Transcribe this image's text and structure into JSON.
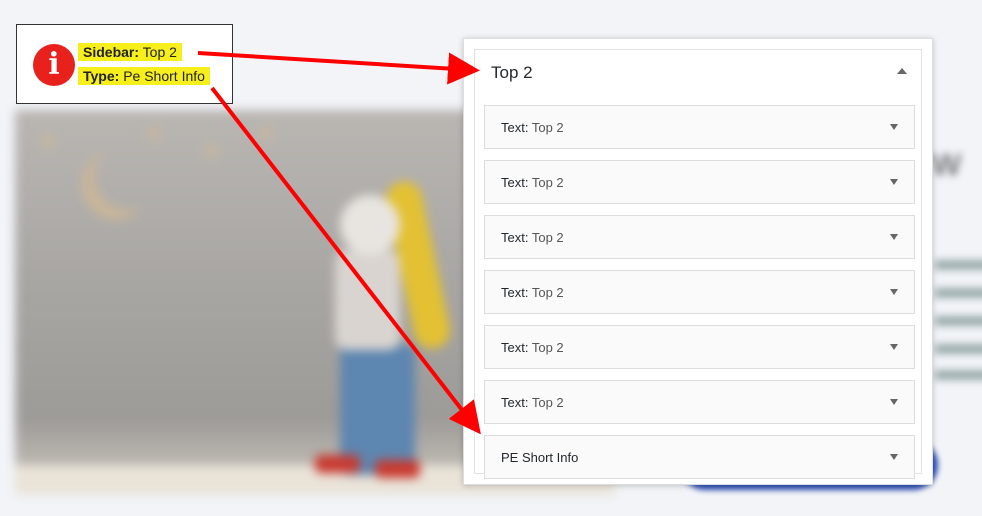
{
  "annotation": {
    "line1_label": "Sidebar:",
    "line1_value": "Top 2",
    "line2_label": "Type:",
    "line2_value": "Pe Short Info"
  },
  "panel": {
    "title": "Top 2",
    "widgets": [
      {
        "prefix": "Text:",
        "value": "Top 2"
      },
      {
        "prefix": "Text:",
        "value": "Top 2"
      },
      {
        "prefix": "Text:",
        "value": "Top 2"
      },
      {
        "prefix": "Text:",
        "value": "Top 2"
      },
      {
        "prefix": "Text:",
        "value": "Top 2"
      },
      {
        "prefix": "Text:",
        "value": "Top 2"
      },
      {
        "prefix": "PE Short Info",
        "value": ""
      }
    ]
  },
  "colors": {
    "arrow": "#ff0000",
    "highlight": "#f7ef1b",
    "info_icon": "#e8211c"
  },
  "icons": {
    "info": "info-icon",
    "collapse": "chevron-up-icon",
    "expand": "chevron-down-icon"
  }
}
